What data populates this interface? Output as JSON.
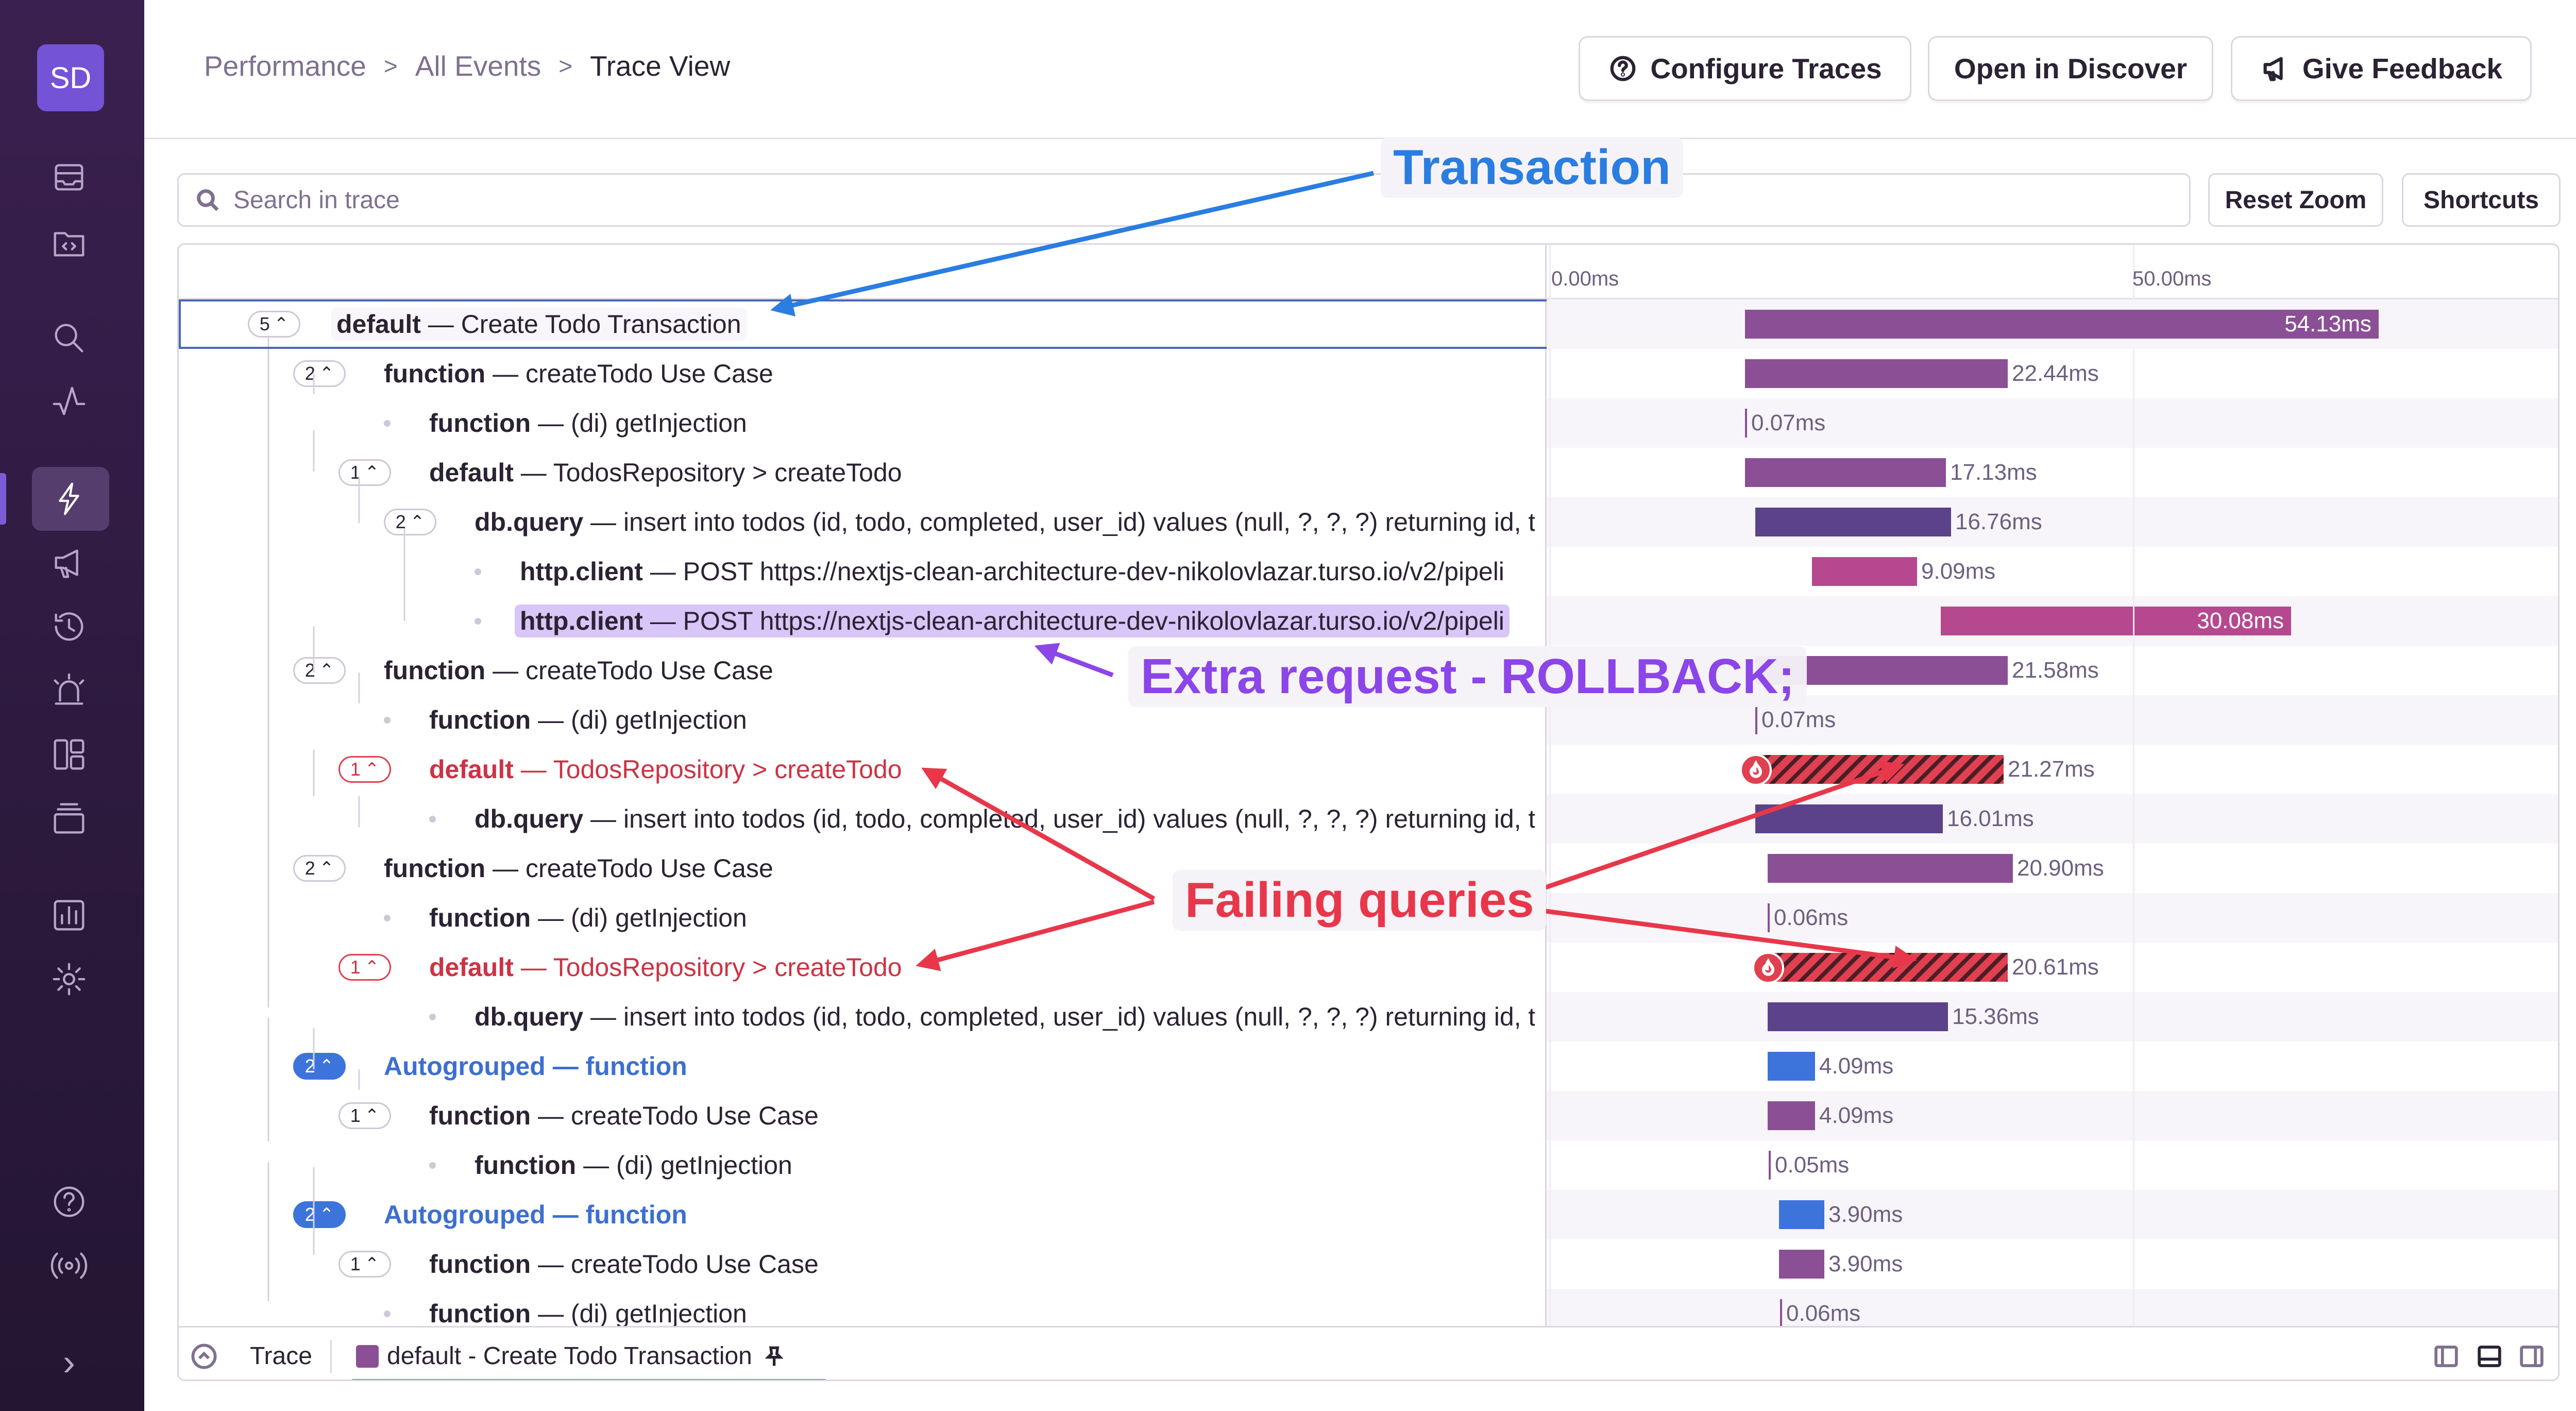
{
  "sidebar": {
    "org_initials": "SD",
    "expand_glyph": "›"
  },
  "header": {
    "breadcrumb": [
      "Performance",
      "All Events",
      "Trace View"
    ],
    "buttons": {
      "configure": "Configure Traces",
      "discover": "Open in Discover",
      "feedback": "Give Feedback"
    }
  },
  "search": {
    "placeholder": "Search in trace",
    "reset_zoom": "Reset Zoom",
    "shortcuts": "Shortcuts"
  },
  "timeline": {
    "ticks": [
      "0.00ms",
      "50.00ms"
    ]
  },
  "rows": [
    {
      "count": "5",
      "op": "default",
      "desc": "Create Todo Transaction",
      "duration": "54.13ms"
    },
    {
      "count": "2",
      "op": "function",
      "desc": "createTodo Use Case",
      "duration": "22.44ms"
    },
    {
      "op": "function",
      "desc": "(di) getInjection",
      "duration": "0.07ms"
    },
    {
      "count": "1",
      "op": "default",
      "desc": "TodosRepository > createTodo",
      "duration": "17.13ms"
    },
    {
      "count": "2",
      "op": "db.query",
      "desc": "insert into todos (id, todo, completed, user_id) values (null, ?, ?, ?) returning id, to",
      "duration": "16.76ms"
    },
    {
      "op": "http.client",
      "desc": "POST https://nextjs-clean-architecture-dev-nikolovlazar.turso.io/v2/pipeli",
      "duration": "9.09ms"
    },
    {
      "op": "http.client",
      "desc": "POST https://nextjs-clean-architecture-dev-nikolovlazar.turso.io/v2/pipeli",
      "duration": "30.08ms"
    },
    {
      "count": "2",
      "op": "function",
      "desc": "createTodo Use Case",
      "duration": "21.58ms"
    },
    {
      "op": "function",
      "desc": "(di) getInjection",
      "duration": "0.07ms"
    },
    {
      "count": "1",
      "op": "default",
      "desc": "TodosRepository > createTodo",
      "duration": "21.27ms"
    },
    {
      "op": "db.query",
      "desc": "insert into todos (id, todo, completed, user_id) values (null, ?, ?, ?) returning id, to",
      "duration": "16.01ms"
    },
    {
      "count": "2",
      "op": "function",
      "desc": "createTodo Use Case",
      "duration": "20.90ms"
    },
    {
      "op": "function",
      "desc": "(di) getInjection",
      "duration": "0.06ms"
    },
    {
      "count": "1",
      "op": "default",
      "desc": "TodosRepository > createTodo",
      "duration": "20.61ms"
    },
    {
      "op": "db.query",
      "desc": "insert into todos (id, todo, completed, user_id) values (null, ?, ?, ?) returning id, to",
      "duration": "15.36ms"
    },
    {
      "count": "2",
      "op": "Autogrouped",
      "desc": "function",
      "duration": "4.09ms"
    },
    {
      "count": "1",
      "op": "function",
      "desc": "createTodo Use Case",
      "duration": "4.09ms"
    },
    {
      "op": "function",
      "desc": "(di) getInjection",
      "duration": "0.05ms"
    },
    {
      "count": "2",
      "op": "Autogrouped",
      "desc": "function",
      "duration": "3.90ms"
    },
    {
      "count": "1",
      "op": "function",
      "desc": "createTodo Use Case",
      "duration": "3.90ms"
    },
    {
      "op": "function",
      "desc": "(di) getInjection",
      "duration": "0.06ms"
    }
  ],
  "footer": {
    "trace_tab": "Trace",
    "active_tab": "default - Create Todo Transaction"
  },
  "annotations": {
    "transaction": "Transaction",
    "extra_request": "Extra request - ROLLBACK;",
    "failing_queries": "Failing queries"
  },
  "colors": {
    "transaction_annotation": "#2a7de1",
    "extra_request_annotation": "#8b45e8",
    "failing_annotation": "#e8374a",
    "selection_outline": "#4a66b8",
    "span_default": "#8b4f96",
    "span_db": "#5b4289",
    "span_http": "#b5488f",
    "span_autogrouped": "#3d74db"
  }
}
